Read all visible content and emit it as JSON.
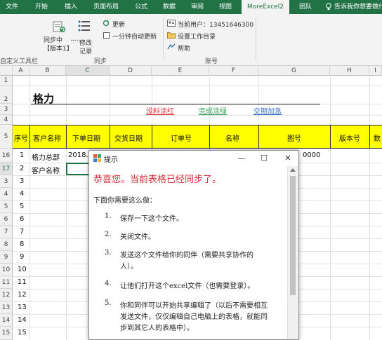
{
  "ribbon": {
    "tabs": [
      "文件",
      "开始",
      "插入",
      "页面布局",
      "公式",
      "数据",
      "审阅",
      "视图",
      "MoreExcel2",
      "团队",
      "告诉我你想要做什么"
    ],
    "active_tab": "MoreExcel2",
    "sync_button": {
      "line1": "同步中",
      "line2": "【版本1】"
    },
    "more_icon_label": "......",
    "modify_record": {
      "line1": "修改",
      "line2": "记录"
    },
    "update_label": "更新",
    "auto_update_label": "一分钟自动更新",
    "sync_group_label": "同步",
    "current_user": "当前用户：13451646300",
    "set_workdir": "设置工作目录",
    "help": "帮助",
    "account_group_label": "账号",
    "custom_toolbar_label": "自定义工具栏"
  },
  "sheet": {
    "columns": [
      "A",
      "B",
      "C",
      "D",
      "E",
      "F",
      "G",
      "H",
      "I"
    ],
    "row_numbers": [
      "1",
      "2",
      "3",
      "4",
      "5",
      "16",
      "17",
      "3",
      "4",
      "5",
      "6",
      "7",
      "8",
      "9",
      "10",
      "11",
      "12",
      "13",
      "14",
      "15"
    ],
    "title": "格力",
    "legend": {
      "shortage_red": "没料涂红",
      "done_green": "完成涂绿",
      "due_blue": "交期加急"
    },
    "legend_colors": {
      "red": "#e0343c",
      "green": "#3aa05a",
      "blue": "#3b6fc4"
    },
    "header_fill": "#ffff00",
    "headers": [
      "序号",
      "客户名称",
      "下单日期",
      "交货日期",
      "订单号",
      "名称",
      "图号",
      "版本号",
      "数"
    ],
    "row16": {
      "seq": "1",
      "customer": "格力总部",
      "date": "2018.",
      "drawing_tail": "0000"
    },
    "row17": {
      "seq": "2",
      "customer": "客户名称"
    },
    "extra_rows": [
      "3",
      "4",
      "5",
      "6",
      "7",
      "8",
      "9",
      "10",
      "11",
      "12",
      "13",
      "14",
      "15"
    ]
  },
  "dialog": {
    "title": "提示",
    "congrats": "恭喜您。当前表格已经同步了。",
    "intro": "下面你需要这么做：",
    "steps": [
      {
        "num": "1.",
        "lines": [
          "保存一下这个文件。"
        ]
      },
      {
        "num": "2.",
        "lines": [
          "关闭文件。"
        ]
      },
      {
        "num": "3.",
        "lines": [
          "发送这个文件给你的同伴（需要共享协作的",
          "人）。"
        ]
      },
      {
        "num": "4.",
        "lines": [
          "让他们打开这个excel文件（也需要登录）。"
        ]
      },
      {
        "num": "5.",
        "lines": [
          "你和同伴可以开始共享编辑了（以后不需要相互",
          "发送文件，仅仅编辑自己电脑上的表格，就能同",
          "步到其它人的表格中）。"
        ]
      }
    ],
    "congrats_color": "#d6303a"
  }
}
